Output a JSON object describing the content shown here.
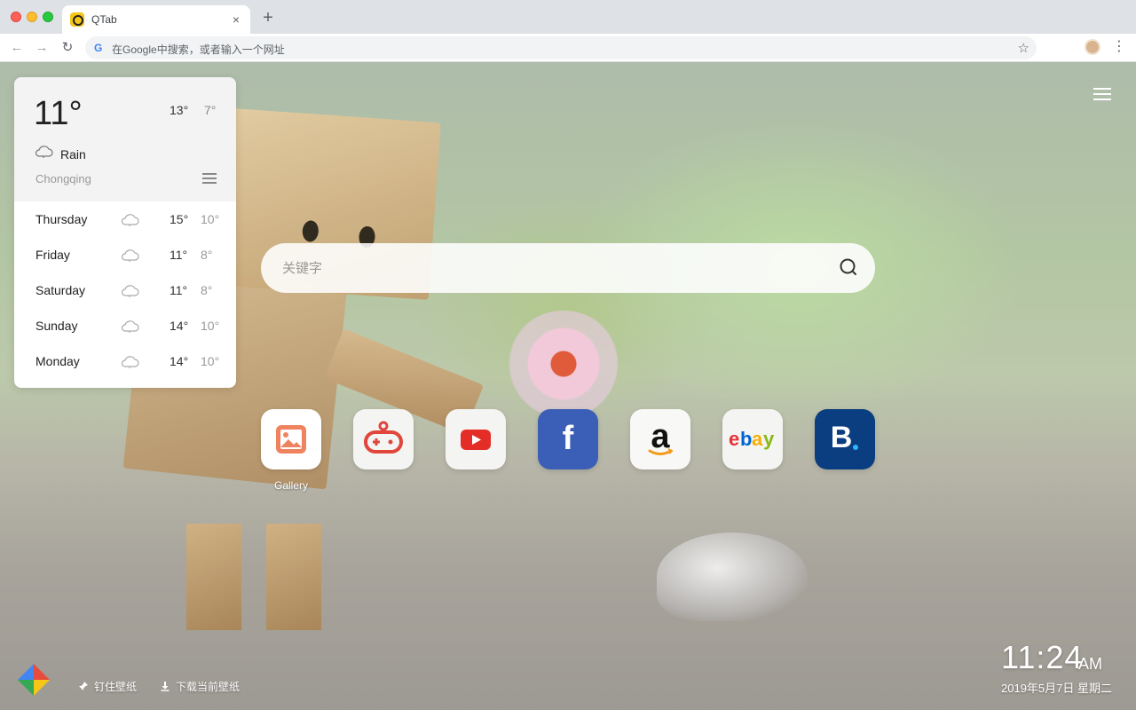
{
  "browser": {
    "tab_title": "QTab",
    "tab_close": "×",
    "new_tab": "+",
    "back": "←",
    "forward": "→",
    "reload": "↻",
    "google_icon": "G",
    "omnibox_placeholder": "在Google中搜索，或者输入一个网址",
    "star": "☆",
    "menu": "⋮"
  },
  "weather": {
    "current_temp": "11°",
    "today_high": "13°",
    "today_low": "7°",
    "condition": "Rain",
    "city": "Chongqing",
    "icon": "cloud-icon",
    "forecast": [
      {
        "day": "Thursday",
        "high": "15°",
        "low": "10°"
      },
      {
        "day": "Friday",
        "high": "11°",
        "low": "8°"
      },
      {
        "day": "Saturday",
        "high": "11°",
        "low": "8°"
      },
      {
        "day": "Sunday",
        "high": "14°",
        "low": "10°"
      },
      {
        "day": "Monday",
        "high": "14°",
        "low": "10°"
      }
    ]
  },
  "search": {
    "placeholder": "关键字",
    "icon": "search-icon"
  },
  "shortcuts": [
    {
      "name": "gallery",
      "label": "Gallery",
      "icon": "gallery-icon",
      "color": "#f0835f"
    },
    {
      "name": "games",
      "label": "",
      "icon": "gamepad-icon",
      "color": "#e0463c"
    },
    {
      "name": "youtube",
      "label": "",
      "icon": "youtube-icon",
      "color": "#e52d27"
    },
    {
      "name": "facebook",
      "label": "",
      "icon": "facebook-icon",
      "color": "#3b5fb6",
      "glyph": "f"
    },
    {
      "name": "amazon",
      "label": "",
      "icon": "amazon-icon",
      "color": "#111111",
      "glyph": "a"
    },
    {
      "name": "ebay",
      "label": "",
      "icon": "ebay-icon",
      "color": "#e53238"
    },
    {
      "name": "booking",
      "label": "",
      "icon": "booking-icon",
      "color": "#0b3e80",
      "glyph": "B"
    }
  ],
  "footer": {
    "pin_wallpaper": "钉住壁纸",
    "download_wallpaper": "下载当前壁纸",
    "pin_icon": "pin-icon",
    "download_icon": "download-icon"
  },
  "clock": {
    "time": "11:24",
    "ampm": "AM",
    "date": "2019年5月7日  星期二"
  }
}
